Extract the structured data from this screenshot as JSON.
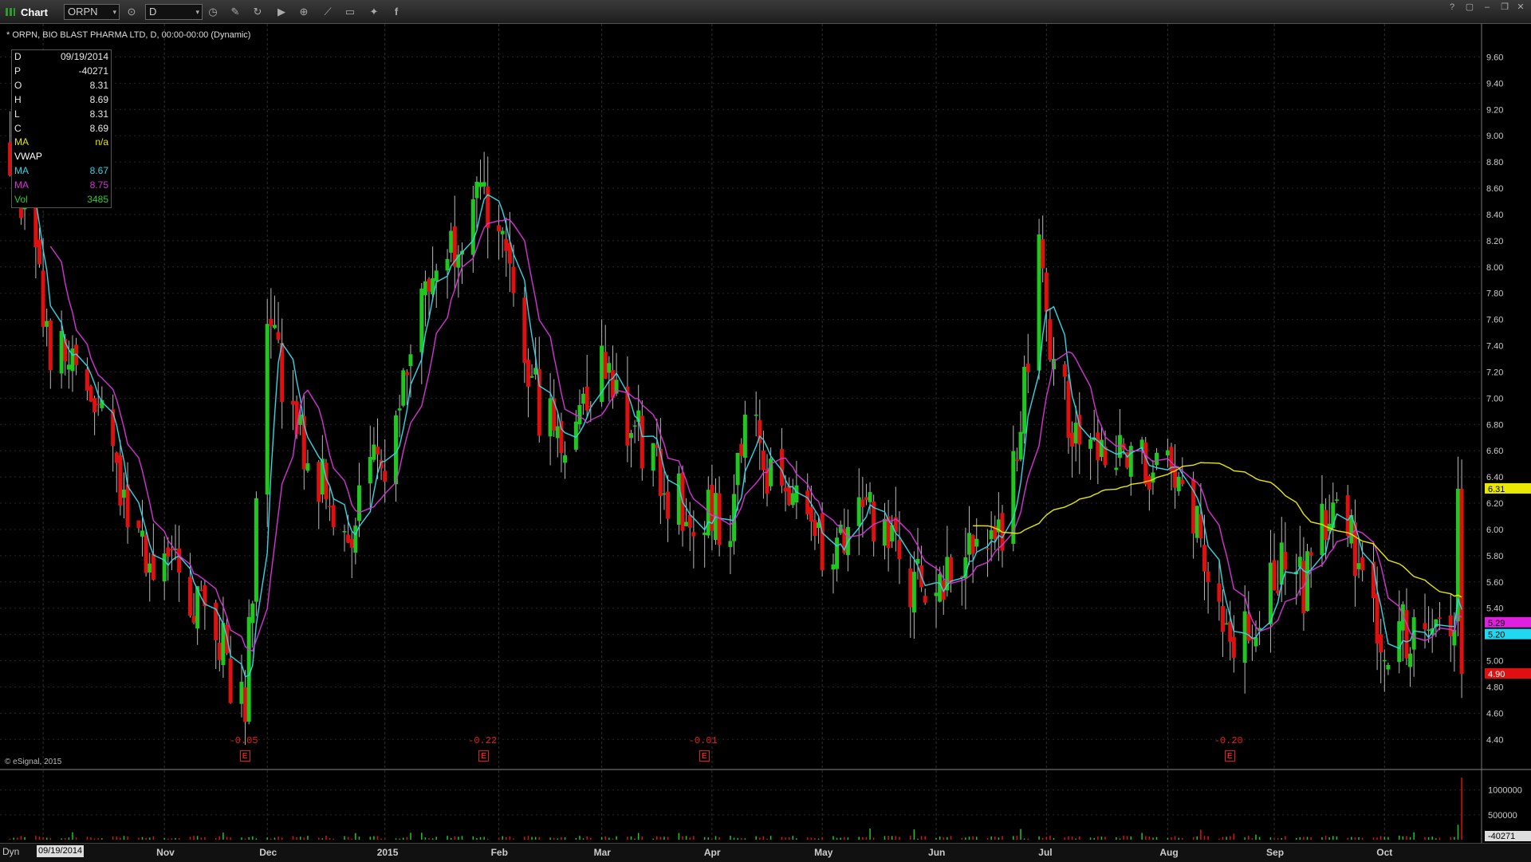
{
  "window": {
    "title": "Chart",
    "symbol": "ORPN",
    "interval": "D",
    "button_icons": [
      "link-icon",
      "cursor-icon",
      "refresh-icon",
      "play-icon",
      "zoom-icon",
      "draw-icon",
      "chat-icon",
      "twitter-icon",
      "facebook-icon"
    ]
  },
  "chart_title": "* ORPN, BIO BLAST PHARMA LTD, D, 00:00-00:00 (Dynamic)",
  "data_window": [
    {
      "label": "D",
      "value": "09/19/2014",
      "color": "#e8e8e8"
    },
    {
      "label": "P",
      "value": "-40271",
      "color": "#e8e8e8"
    },
    {
      "label": "O",
      "value": "8.31",
      "color": "#e8e8e8"
    },
    {
      "label": "H",
      "value": "8.69",
      "color": "#e8e8e8"
    },
    {
      "label": "L",
      "value": "8.31",
      "color": "#e8e8e8"
    },
    {
      "label": "C",
      "value": "8.69",
      "color": "#e8e8e8"
    },
    {
      "label": "MA",
      "value": "n/a",
      "color": "#e8e800"
    },
    {
      "label": "VWAP",
      "value": "",
      "color": "#ffffff"
    },
    {
      "label": "MA",
      "value": "8.67",
      "color": "#33d6e6"
    },
    {
      "label": "MA",
      "value": "8.75",
      "color": "#d633d6"
    },
    {
      "label": "Vol",
      "value": "3485",
      "color": "#33cc33"
    }
  ],
  "watermark": "© eSignal, 2015",
  "footer": {
    "dyn": "Dyn",
    "date": "09/19/2014"
  },
  "earnings": [
    {
      "label": "-0.05",
      "date": "2014-11-25"
    },
    {
      "label": "-0.22",
      "date": "2015-01-29"
    },
    {
      "label": "-0.01",
      "date": "2015-03-30"
    },
    {
      "label": "-0.20",
      "date": "2015-08-20"
    }
  ],
  "chart_data": {
    "type": "candlestick",
    "title": "* ORPN, BIO BLAST PHARMA LTD, D, 00:00-00:00 (Dynamic)",
    "x_range": [
      "2014-09-22",
      "2015-10-22"
    ],
    "month_labels": [
      "Nov",
      "Dec",
      "2015",
      "Feb",
      "Mar",
      "Apr",
      "May",
      "Jun",
      "Jul",
      "Aug",
      "Sep",
      "Oct"
    ],
    "month_dates": [
      "2014-11-03",
      "2014-12-01",
      "2015-01-02",
      "2015-02-02",
      "2015-03-02",
      "2015-04-01",
      "2015-05-01",
      "2015-06-01",
      "2015-07-01",
      "2015-08-03",
      "2015-09-01",
      "2015-10-01"
    ],
    "price_axis": {
      "min": 4.25,
      "max": 9.7,
      "ticks": [
        4.4,
        4.6,
        4.8,
        5.0,
        5.2,
        5.4,
        5.6,
        5.8,
        6.0,
        6.2,
        6.4,
        6.6,
        6.8,
        7.0,
        7.2,
        7.4,
        7.6,
        7.8,
        8.0,
        8.2,
        8.4,
        8.6,
        8.8,
        9.0,
        9.2,
        9.4,
        9.6
      ]
    },
    "volume_axis": {
      "max": 1300000,
      "ticks": [
        500000,
        1000000
      ],
      "tick_labels": [
        "500000",
        "1000000"
      ]
    },
    "price_labels": [
      {
        "value": 6.31,
        "text": "6.31",
        "color": "#e8e800"
      },
      {
        "value": 5.29,
        "text": "5.29",
        "color": "#e020e0"
      },
      {
        "value": 5.2,
        "text": "5.20",
        "color": "#20d8f0"
      },
      {
        "value": 4.9,
        "text": "4.90",
        "color": "#e01010"
      }
    ],
    "volume_label": {
      "text": "-40271"
    },
    "anchors": [
      [
        "2014-09-22",
        8.9
      ],
      [
        "2014-10-03",
        7.4
      ],
      [
        "2014-10-14",
        7.0
      ],
      [
        "2014-10-27",
        5.9
      ],
      [
        "2014-11-05",
        5.7
      ],
      [
        "2014-11-17",
        5.2
      ],
      [
        "2014-11-25",
        4.65
      ],
      [
        "2014-12-01",
        7.7
      ],
      [
        "2014-12-08",
        6.8
      ],
      [
        "2014-12-15",
        6.4
      ],
      [
        "2014-12-22",
        5.9
      ],
      [
        "2015-01-02",
        6.6
      ],
      [
        "2015-01-08",
        7.4
      ],
      [
        "2015-01-14",
        7.9
      ],
      [
        "2015-01-22",
        8.3
      ],
      [
        "2015-01-30",
        8.5
      ],
      [
        "2015-02-05",
        7.8
      ],
      [
        "2015-02-12",
        7.0
      ],
      [
        "2015-02-20",
        6.7
      ],
      [
        "2015-03-02",
        7.3
      ],
      [
        "2015-03-10",
        6.8
      ],
      [
        "2015-03-18",
        6.4
      ],
      [
        "2015-03-26",
        6.1
      ],
      [
        "2015-04-06",
        6.1
      ],
      [
        "2015-04-10",
        6.9
      ],
      [
        "2015-04-20",
        6.2
      ],
      [
        "2015-04-28",
        6.0
      ],
      [
        "2015-05-05",
        5.8
      ],
      [
        "2015-05-13",
        6.1
      ],
      [
        "2015-05-22",
        5.7
      ],
      [
        "2015-06-01",
        5.5
      ],
      [
        "2015-06-10",
        5.9
      ],
      [
        "2015-06-18",
        5.9
      ],
      [
        "2015-06-24",
        6.8
      ],
      [
        "2015-06-29",
        8.1
      ],
      [
        "2015-07-02",
        7.1
      ],
      [
        "2015-07-10",
        6.8
      ],
      [
        "2015-07-20",
        6.5
      ],
      [
        "2015-07-27",
        6.6
      ],
      [
        "2015-08-03",
        6.4
      ],
      [
        "2015-08-10",
        6.1
      ],
      [
        "2015-08-20",
        5.3
      ],
      [
        "2015-08-26",
        5.1
      ],
      [
        "2015-09-01",
        5.7
      ],
      [
        "2015-09-10",
        5.6
      ],
      [
        "2015-09-17",
        6.3
      ],
      [
        "2015-09-25",
        5.7
      ],
      [
        "2015-10-02",
        5.1
      ],
      [
        "2015-10-09",
        5.3
      ],
      [
        "2015-10-16",
        5.3
      ],
      [
        "2015-10-20",
        5.2
      ],
      [
        "2015-10-21",
        6.31
      ],
      [
        "2015-10-22",
        4.9
      ]
    ],
    "series": [
      {
        "name": "MA",
        "color": "#e8e800"
      },
      {
        "name": "MA",
        "color": "#33d6e6"
      },
      {
        "name": "MA",
        "color": "#d633d6"
      }
    ],
    "up_color": "#1ec81e",
    "down_color": "#e01010",
    "grid": true
  }
}
